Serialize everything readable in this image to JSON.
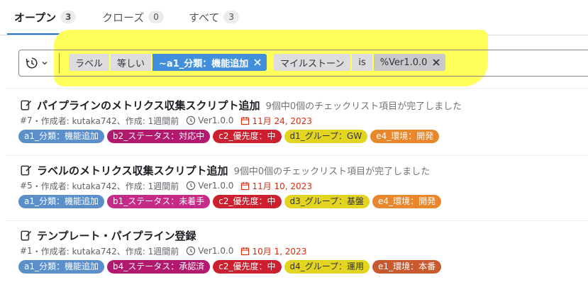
{
  "tabs": [
    {
      "label": "オープン",
      "count": "3"
    },
    {
      "label": "クローズ",
      "count": "0"
    },
    {
      "label": "すべて",
      "count": "3"
    }
  ],
  "filter": {
    "history_icon": "history-icon",
    "tokens": [
      {
        "key": "ラベル",
        "op": "等しい",
        "value": "~a1_分類：機能追加"
      },
      {
        "key": "マイルストーン",
        "op": "is",
        "value": "%Ver1.0.0"
      }
    ]
  },
  "issues": [
    {
      "title": "パイプラインのメトリクス収集スクリプト追加",
      "tasks": "9個中0個のチェックリスト項目が完了しました",
      "ref": "#7",
      "author": "・作成者: kutaka742、作成: 1週間前",
      "milestone": "Ver1.0.0",
      "due": "11月 24, 2023",
      "labels": [
        "a1_分類：機能追加",
        "b2_ステータス：対応中",
        "c2_優先度：中",
        "d1_グループ：GW",
        "e4_環境：開発"
      ]
    },
    {
      "title": "ラベルのメトリクス収集スクリプト追加",
      "tasks": "9個中0個のチェックリスト項目が完了しました",
      "ref": "#5",
      "author": "・作成者: kutaka742、作成: 1週間前",
      "milestone": "Ver1.0.0",
      "due": "11月 10, 2023",
      "labels": [
        "a1_分類：機能追加",
        "b1_ステータス：未着手",
        "c2_優先度：中",
        "d3_グループ：基盤",
        "e4_環境：開発"
      ]
    },
    {
      "title": "テンプレート・パイプライン登録",
      "tasks": "",
      "ref": "#1",
      "author": "・作成者: kutaka742、作成: 1週間前",
      "milestone": "Ver1.0.0",
      "due": "10月 1, 2023",
      "labels": [
        "a1_分類：機能追加",
        "b4_ステータス：承認済",
        "c2_優先度：中",
        "d4_グループ：運用",
        "e1_環境：本番"
      ]
    }
  ],
  "colors": {
    "accent": "#1f75cb",
    "highlight": "#ffff5c",
    "due": "#dd2b0e"
  }
}
